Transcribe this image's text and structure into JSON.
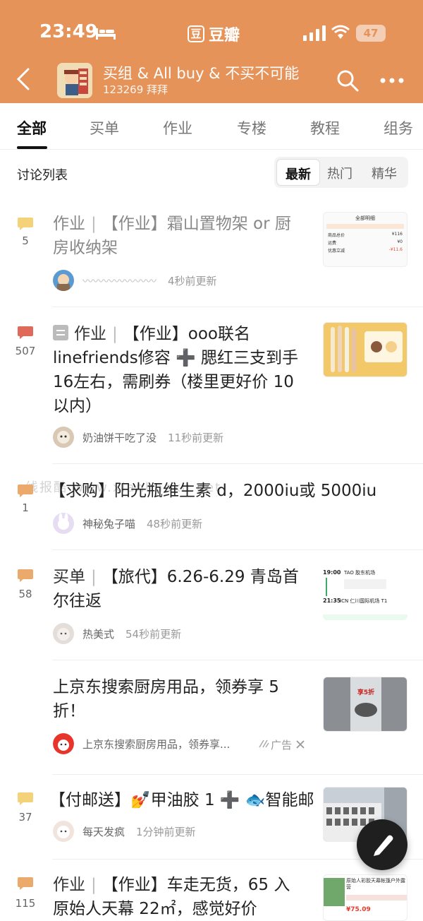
{
  "status": {
    "time": "23:49",
    "app_name": "豆瓣",
    "app_logo": "豆",
    "battery": "47"
  },
  "header": {
    "title": "买组 & All buy & 不买不可能",
    "members": "123269 拜拜"
  },
  "tabs": [
    "全部",
    "买单",
    "作业",
    "专楼",
    "教程",
    "组务"
  ],
  "list_header": "讨论列表",
  "sort": [
    "最新",
    "热门",
    "精华"
  ],
  "watermark": "线报酷 www.xianbaoku.net",
  "colors": {
    "brand": "#E6935A",
    "comment_orange": "#EBA96C",
    "comment_yellow": "#F3D27A",
    "comment_red": "#E06A5A"
  },
  "posts": [
    {
      "count": "5",
      "category": "作业",
      "sep": "|",
      "title_line1": "【作业】霜山置物架 or 厨",
      "title_line2": "房收纳架",
      "author": "〰〰〰〰〰〰〰",
      "time": "4秒前更新",
      "thumb": {
        "label": "全部明细",
        "row1": "商品总价",
        "row1_val": "¥116",
        "row2": "运费",
        "row2_val": "¥0",
        "row3": "优惠立减",
        "row3_val": "-¥11.6"
      }
    },
    {
      "count": "507",
      "category": "作业",
      "sep": "|",
      "title_line1": "【作业】ooo联名",
      "title_line2": "linefriends修容 ➕ 腮红三支到手",
      "title_line3": "16左右，需刷券（楼里更好价 10",
      "title_line4": "以内）",
      "author": "奶油饼干吃了没",
      "time": "11秒前更新"
    },
    {
      "count": "1",
      "title_line1": "【求购】阳光瓶维生素 d，2000iu或 5000iu",
      "author": "神秘兔子喵",
      "time": "48秒前更新"
    },
    {
      "count": "58",
      "category": "买单",
      "sep": "|",
      "title_line1": "【旅代】6.26-6.29 青岛首",
      "title_line2": "尔往返",
      "author": "热美式",
      "time": "54秒前更新",
      "thumb": {
        "t1": "19:00",
        "t2": "21:35",
        "l1": "TAO 胶东机场",
        "l2": "ICN 仁川国际机场 T1"
      }
    },
    {
      "title_line1": "上京东搜索厨房用品，领券享 5",
      "title_line2": "折！",
      "author": "上京东搜索厨房用品，领券享...",
      "ad": "广告",
      "thumb": {
        "text": "享5折"
      }
    },
    {
      "count": "37",
      "title_line1": "【付邮送】💅甲油胶 1 ➕ 🐟智能邮",
      "author": "每天发疯",
      "time": "1分钟前更新"
    },
    {
      "count": "115",
      "category": "作业",
      "sep": "|",
      "title_line1": "【作业】车走无货，65 入",
      "title_line2": "原始人天幕 22㎡，感觉好价",
      "thumb": {
        "text": "原始人彩胶天幕帐篷户外露营",
        "price": "¥75.09"
      }
    }
  ]
}
